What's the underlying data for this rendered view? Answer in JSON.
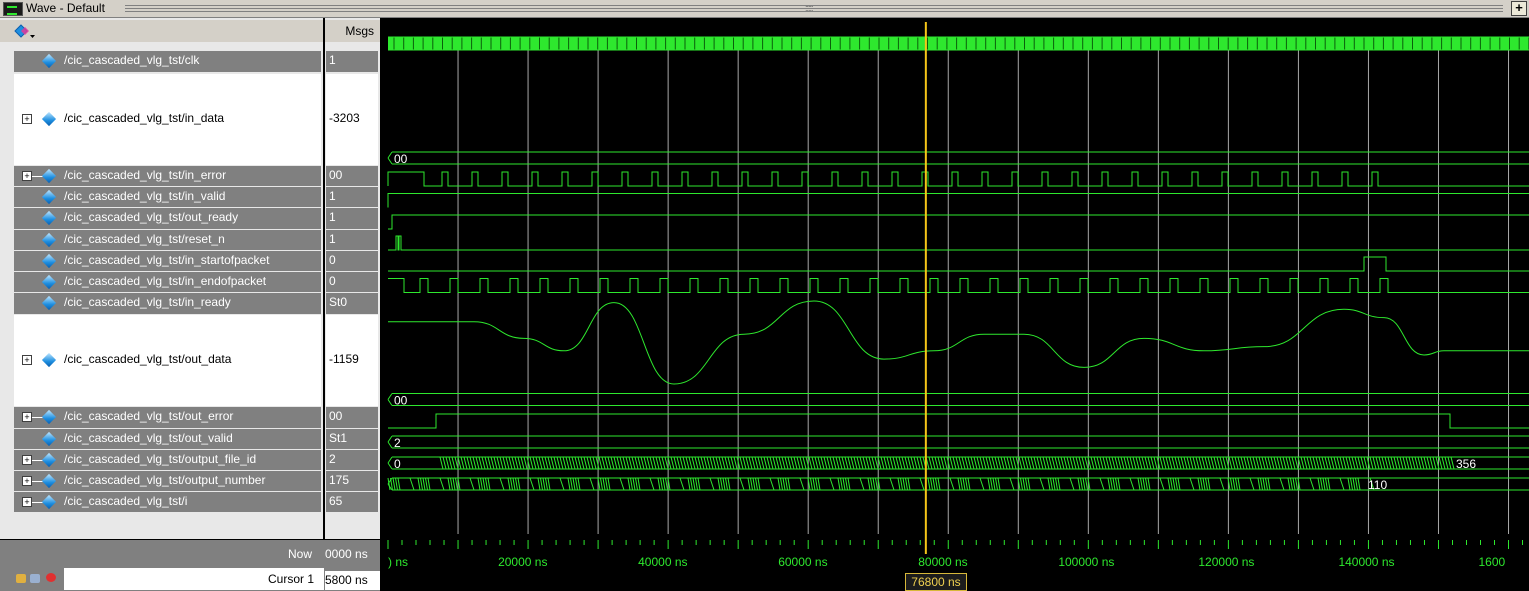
{
  "window": {
    "title": "Wave - Default"
  },
  "columns": {
    "msgs_header": "Msgs"
  },
  "colors": {
    "wave": "#2ee82e",
    "cursor": "#f5c518",
    "grid": "#a8a8a8",
    "row_bg": "#808080",
    "diamond": "#1e8fe0"
  },
  "signals": [
    {
      "name": "/cic_cascaded_vlg_tst/clk",
      "value": "1",
      "expandable": false,
      "tall": false,
      "icon": "diamond-icon"
    },
    {
      "name": "/cic_cascaded_vlg_tst/in_data",
      "value": "-3203",
      "expandable": true,
      "tall": true,
      "icon": "diamond-icon"
    },
    {
      "name": "/cic_cascaded_vlg_tst/in_error",
      "value": "00",
      "expandable": true,
      "tall": false,
      "icon": "diamond-icon"
    },
    {
      "name": "/cic_cascaded_vlg_tst/in_valid",
      "value": "1",
      "expandable": false,
      "tall": false,
      "icon": "diamond-icon"
    },
    {
      "name": "/cic_cascaded_vlg_tst/out_ready",
      "value": "1",
      "expandable": false,
      "tall": false,
      "icon": "diamond-icon"
    },
    {
      "name": "/cic_cascaded_vlg_tst/reset_n",
      "value": "1",
      "expandable": false,
      "tall": false,
      "icon": "diamond-icon"
    },
    {
      "name": "/cic_cascaded_vlg_tst/in_startofpacket",
      "value": "0",
      "expandable": false,
      "tall": false,
      "icon": "diamond-icon"
    },
    {
      "name": "/cic_cascaded_vlg_tst/in_endofpacket",
      "value": "0",
      "expandable": false,
      "tall": false,
      "icon": "diamond-icon"
    },
    {
      "name": "/cic_cascaded_vlg_tst/in_ready",
      "value": "St0",
      "expandable": false,
      "tall": false,
      "icon": "diamond-icon"
    },
    {
      "name": "/cic_cascaded_vlg_tst/out_data",
      "value": "-1159",
      "expandable": true,
      "tall": true,
      "icon": "diamond-icon"
    },
    {
      "name": "/cic_cascaded_vlg_tst/out_error",
      "value": "00",
      "expandable": true,
      "tall": false,
      "icon": "diamond-icon"
    },
    {
      "name": "/cic_cascaded_vlg_tst/out_valid",
      "value": "St1",
      "expandable": false,
      "tall": false,
      "icon": "diamond-icon"
    },
    {
      "name": "/cic_cascaded_vlg_tst/output_file_id",
      "value": "2",
      "expandable": true,
      "tall": false,
      "icon": "diamond-icon"
    },
    {
      "name": "/cic_cascaded_vlg_tst/output_number",
      "value": "175",
      "expandable": true,
      "tall": false,
      "icon": "diamond-icon"
    },
    {
      "name": "/cic_cascaded_vlg_tst/i",
      "value": "65",
      "expandable": true,
      "tall": false,
      "icon": "diamond-icon"
    }
  ],
  "bus_values": {
    "in_error_start": "00",
    "out_error_start": "00",
    "output_file_id_start": "2",
    "output_number_start": "0",
    "output_number_end": "356",
    "i_end": "110"
  },
  "footer": {
    "now_label": "Now",
    "now_value": "0000 ns",
    "cursor_label": "Cursor 1",
    "cursor_value": "5800 ns",
    "cursor_time_label": "76800 ns"
  },
  "timeline": {
    "unit": "ns",
    "tick_labels": [
      ") ns",
      "20000 ns",
      "40000 ns",
      "60000 ns",
      "80000 ns",
      "100000 ns",
      "120000 ns",
      "140000 ns",
      "1600"
    ],
    "tick_times": [
      0,
      20000,
      40000,
      60000,
      80000,
      100000,
      120000,
      140000,
      160000
    ],
    "cursor_time": 76800
  }
}
